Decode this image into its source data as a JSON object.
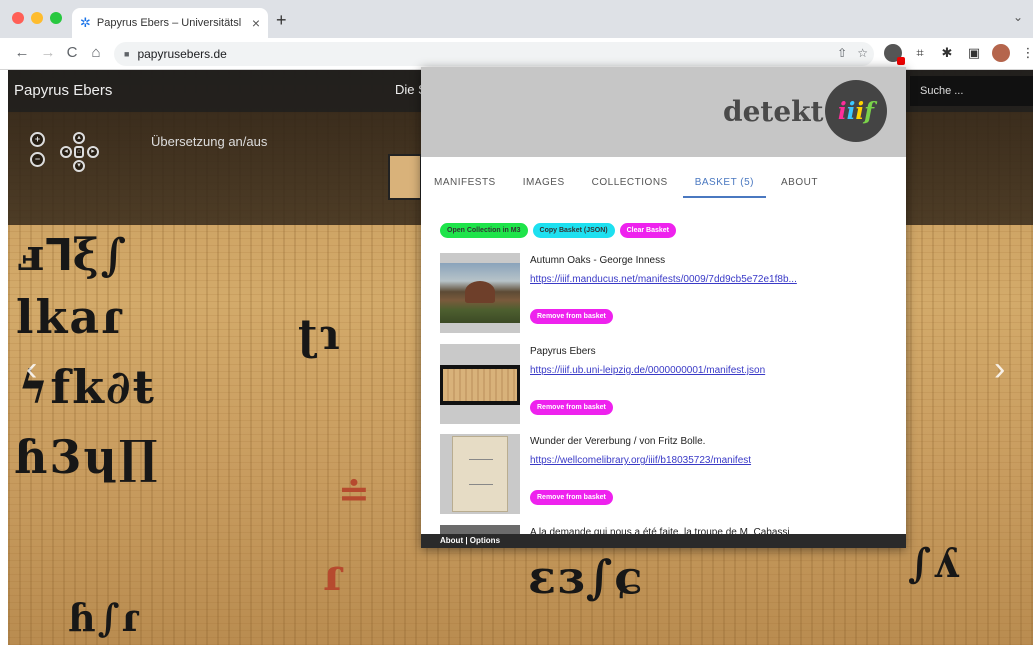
{
  "browser": {
    "tab_title": "Papyrus Ebers – Universitätsl",
    "tab_close": "×",
    "new_tab": "+",
    "tabs_menu": "⌄",
    "url": "papyrusebers.de",
    "nav": {
      "back": "←",
      "forward": "→",
      "reload": "C",
      "home": "⌂"
    }
  },
  "site": {
    "title": "Papyrus Ebers",
    "menu_fragment": "Die S",
    "search_placeholder": "Suche ...",
    "translation_toggle": "Übersetzung an/aus",
    "prev_arrow": "‹",
    "next_arrow": "›"
  },
  "popup": {
    "brand": "detekt",
    "tabs": [
      {
        "label": "MANIFESTS"
      },
      {
        "label": "IMAGES"
      },
      {
        "label": "COLLECTIONS"
      },
      {
        "label": "BASKET (5)"
      },
      {
        "label": "ABOUT"
      }
    ],
    "actions": {
      "open_collection": "Open Collection in M3",
      "copy_basket": "Copy Basket (JSON)",
      "clear_basket": "Clear Basket"
    },
    "items": [
      {
        "title": "Autumn Oaks - George Inness",
        "link": "https://iiif.manducus.net/manifests/0009/7dd9cb5e72e1f8b...",
        "remove": "Remove from basket"
      },
      {
        "title": "Papyrus Ebers",
        "link": "https://iiif.ub.uni-leipzig.de/0000000001/manifest.json",
        "remove": "Remove from basket"
      },
      {
        "title": "Wunder der Vererbung / von Fritz Bolle.",
        "link": "https://wellcomelibrary.org/iiif/b18035723/manifest",
        "remove": "Remove from basket"
      }
    ],
    "partial_item_title": "A la demande qui nous a été faite, la troupe de M. Cabassi",
    "footer": {
      "about": "About",
      "separator": " | ",
      "options": "Options"
    }
  }
}
